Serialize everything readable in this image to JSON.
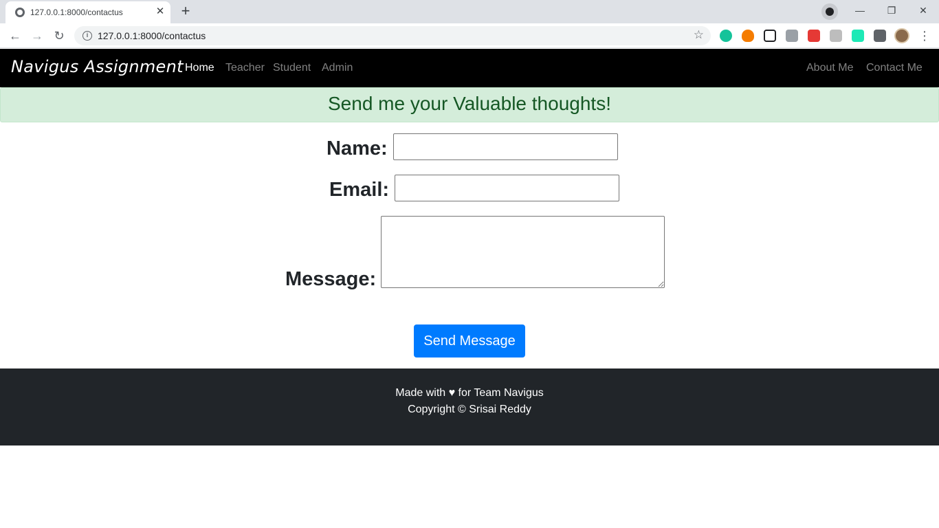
{
  "browser": {
    "tab_title": "127.0.0.1:8000/contactus",
    "tab_close": "✕",
    "new_tab": "+",
    "url": "127.0.0.1:8000/contactus",
    "window_minimize": "—",
    "window_restore": "❐",
    "window_close": "✕",
    "back": "←",
    "forward": "→",
    "reload": "↻",
    "bookmark_star": "☆",
    "menu": "⋮",
    "info": "i"
  },
  "navbar": {
    "brand": "Navigus Assignment",
    "links": {
      "home": "Home",
      "teacher": "Teacher",
      "student": "Student",
      "admin": "Admin",
      "about": "About Me",
      "contact": "Contact Me"
    }
  },
  "alert": {
    "message": "Send me your Valuable thoughts!"
  },
  "form": {
    "name_label": "Name:",
    "name_value": "",
    "email_label": "Email:",
    "email_value": "",
    "message_label": "Message:",
    "message_value": "",
    "submit_label": "Send Message"
  },
  "footer": {
    "line1": "Made with ♥ for Team Navigus",
    "line2": "Copyright © Srisai Reddy"
  },
  "colors": {
    "navbar_bg": "#000000",
    "alert_bg": "#d4edda",
    "alert_text": "#155724",
    "button_bg": "#007bff",
    "footer_bg": "#212529"
  }
}
